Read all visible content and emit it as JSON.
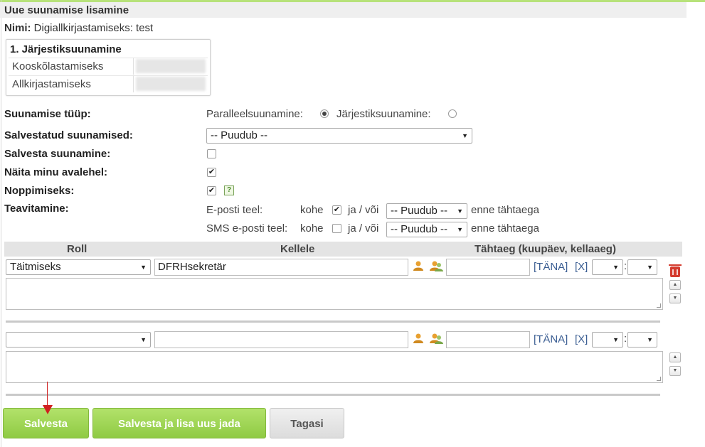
{
  "header": {
    "title": "Uue suunamise lisamine",
    "name_label": "Nimi:",
    "name_value": "Digiallkirjastamiseks: test"
  },
  "flow": {
    "heading": "1. Järjestiksuunamine",
    "rows": [
      {
        "label": "Kooskõlastamiseks"
      },
      {
        "label": "Allkirjastamiseks"
      }
    ]
  },
  "form": {
    "type_label": "Suunamise tüüp:",
    "parallel_label": "Paralleelsuunamine:",
    "sequential_label": "Järjestiksuunamine:",
    "selected_type": "Paralleelsuunamine",
    "saved_label": "Salvestatud suunamised:",
    "saved_value": "-- Puudub --",
    "save_flow_label": "Salvesta suunamine:",
    "save_flow_checked": false,
    "show_home_label": "Näita minu avalehel:",
    "show_home_checked": true,
    "knowledge_label": "Noppimiseks:",
    "knowledge_checked": true,
    "help_glyph": "?",
    "notify_label": "Teavitamine:",
    "email_label": "E-posti teel:",
    "sms_label": "SMS e-posti teel:",
    "kohe": "kohe",
    "ja_voi": "ja / või",
    "email_now_checked": true,
    "sms_now_checked": false,
    "email_deadline": "-- Puudub --",
    "sms_deadline": "-- Puudub --",
    "before_deadline": "enne tähtaega"
  },
  "grid": {
    "col_role": "Roll",
    "col_to": "Kellele",
    "col_deadline": "Tähtaeg (kuupäev, kellaaeg)",
    "today_link": "[TÄNA]",
    "clear_link": "[X]",
    "rows": [
      {
        "role": "Täitmiseks",
        "to": "DFRHsekretär",
        "date": ""
      },
      {
        "role": "",
        "to": "",
        "date": ""
      }
    ]
  },
  "buttons": {
    "save": "Salvesta",
    "save_add": "Salvesta ja lisa uus jada",
    "back": "Tagasi"
  },
  "colors": {
    "accent_green": "#8fca44",
    "link_blue": "#3a5d92",
    "annotation_red": "#d02020"
  }
}
